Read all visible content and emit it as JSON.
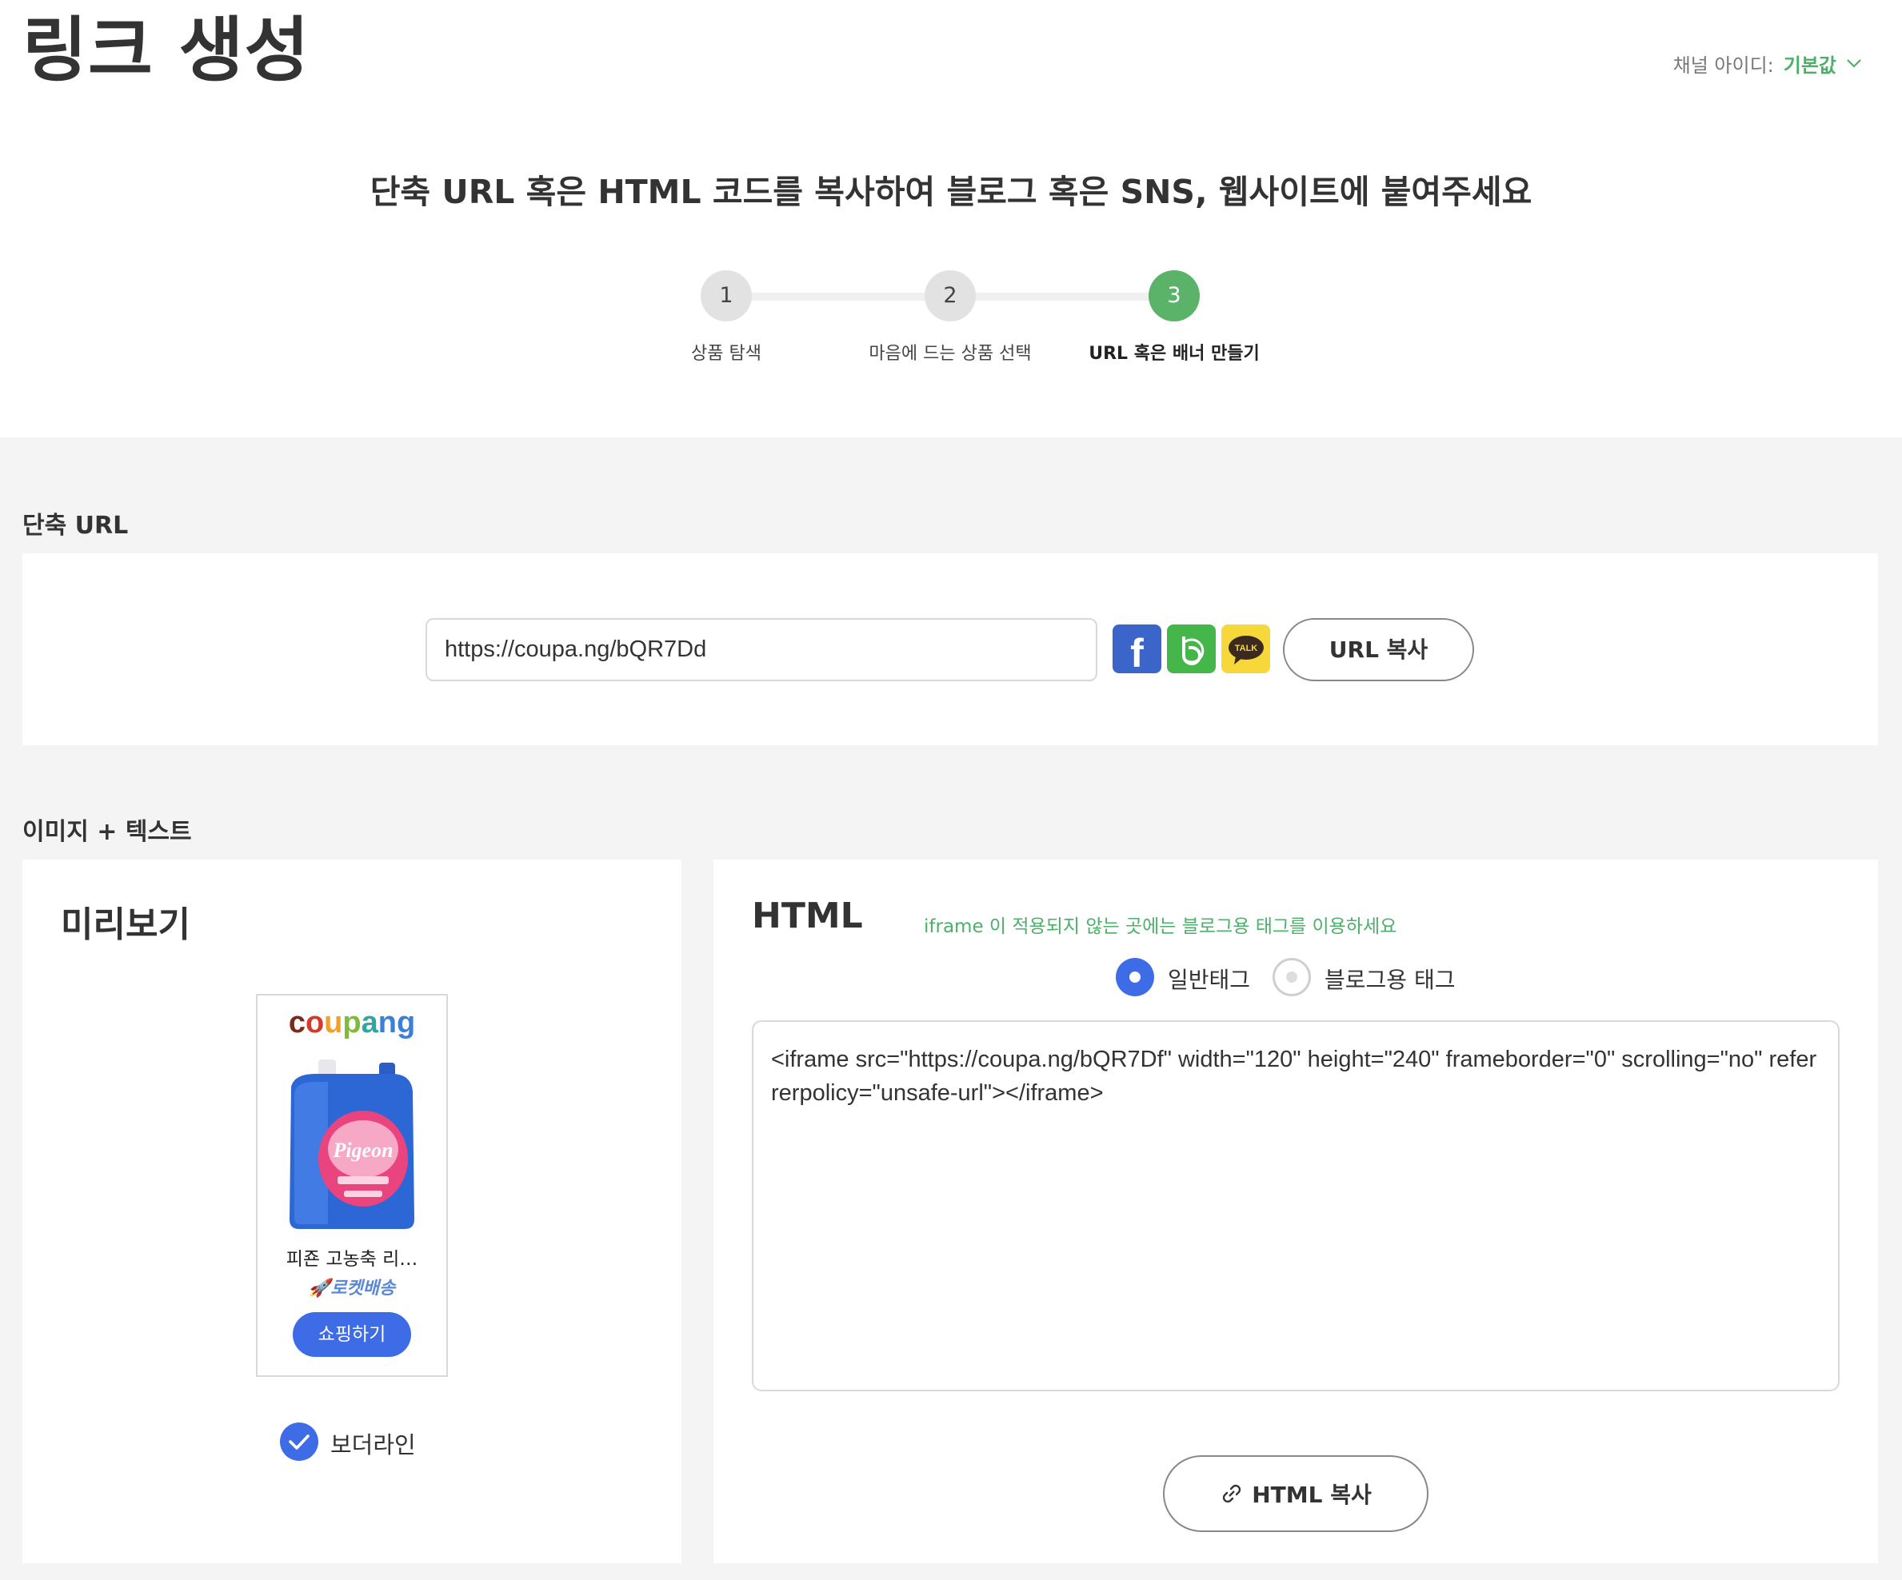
{
  "header": {
    "title": "링크 생성",
    "channel_label": "채널 아이디:",
    "channel_value": "기본값",
    "subtitle": "단축 URL 혹은 HTML 코드를 복사하여 블로그 혹은 SNS, 웹사이트에 붙여주세요"
  },
  "steps": [
    {
      "num": "1",
      "label": "상품 탐색"
    },
    {
      "num": "2",
      "label": "마음에 드는 상품 선택"
    },
    {
      "num": "3",
      "label": "URL 혹은 배너 만들기"
    }
  ],
  "short_url": {
    "section_title": "단축 URL",
    "value": "https://coupa.ng/bQR7Dd",
    "kakao_talk": "TALK",
    "copy_label": "URL 복사"
  },
  "image_text": {
    "section_title": "이미지 + 텍스트",
    "preview_title": "미리보기",
    "widget": {
      "logo": "coupang",
      "brand_on_pack": "Pigeon",
      "product_name": "피죤 고농축 리…",
      "delivery": "로켓배송",
      "shop_button": "쇼핑하기"
    },
    "border_label": "보더라인",
    "border_checked": true
  },
  "html": {
    "title": "HTML",
    "note": "iframe 이 적용되지 않는 곳에는 블로그용 태그를 이용하세요",
    "radio_normal": "일반태그",
    "radio_blog": "블로그용 태그",
    "selected": "일반태그",
    "code": "<iframe src=\"https://coupa.ng/bQR7Df\" width=\"120\" height=\"240\" frameborder=\"0\" scrolling=\"no\" referrerpolicy=\"unsafe-url\"></iframe>",
    "copy_label": "HTML 복사"
  },
  "colors": {
    "accent_green": "#5bb36a",
    "primary_blue": "#3e6be6",
    "facebook": "#3b65c8",
    "band": "#45b649",
    "kakao": "#f6d83a"
  }
}
